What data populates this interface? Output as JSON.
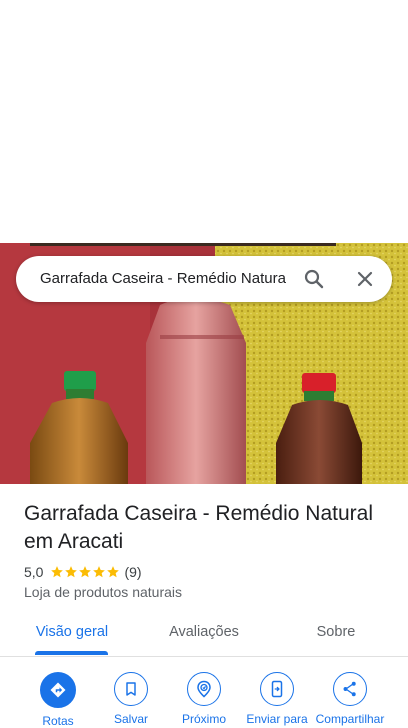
{
  "search": {
    "query": "Garrafada Caseira - Remédio Natura"
  },
  "place": {
    "title": "Garrafada Caseira - Remédio Natural em Aracati",
    "rating": "5,0",
    "stars": 5,
    "review_count": "(9)",
    "category": "Loja de produtos naturais"
  },
  "tabs": [
    {
      "label": "Visão geral",
      "active": true
    },
    {
      "label": "Avaliações",
      "active": false
    },
    {
      "label": "Sobre",
      "active": false
    }
  ],
  "actions": [
    {
      "label": "Rotas",
      "icon": "directions-icon"
    },
    {
      "label": "Salvar",
      "icon": "bookmark-icon"
    },
    {
      "label": "Próximo",
      "icon": "nearby-icon"
    },
    {
      "label": "Enviar para",
      "icon": "send-to-phone-icon"
    },
    {
      "label": "Compartilhar",
      "icon": "share-icon"
    }
  ],
  "colors": {
    "accent": "#1a73e8",
    "star": "#fbbc04",
    "text": "#202124"
  }
}
